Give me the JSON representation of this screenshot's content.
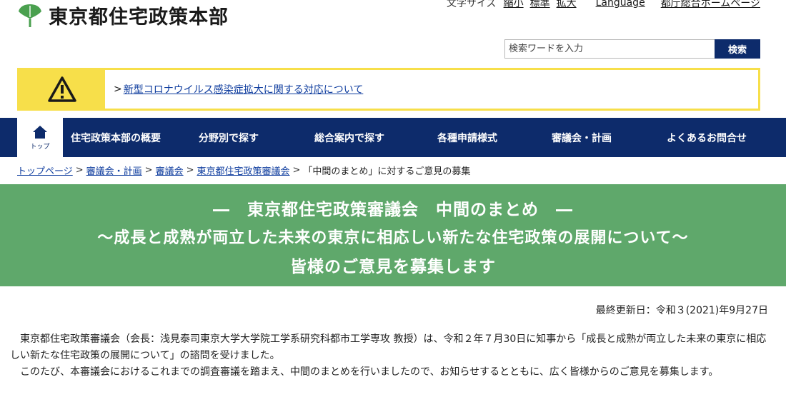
{
  "header": {
    "site_title": "東京都住宅政策本部",
    "logo_icon": "ginkgo-leaf-icon",
    "logo_color": "#4aa04f",
    "font_size_label": "文字サイズ",
    "font_small": "縮小",
    "font_standard": "標準",
    "font_large": "拡大",
    "language": "Language",
    "tocho_home": "都庁総合ホームページ"
  },
  "search": {
    "placeholder": "検索ワードを入力",
    "button_label": "検索"
  },
  "alert": {
    "icon": "warning-triangle-icon",
    "arrow": ">",
    "link_text": "新型コロナウイルス感染症拡大に関する対応について",
    "color": "#f7df4a"
  },
  "nav": {
    "home_label": "トップ",
    "items": [
      {
        "label": "住宅政策本部の概要"
      },
      {
        "label": "分野別で探す"
      },
      {
        "label": "総合案内で探す"
      },
      {
        "label": "各種申請様式"
      },
      {
        "label": "審議会・計画"
      },
      {
        "label": "よくあるお問合せ"
      }
    ],
    "color": "#0d2b6b"
  },
  "breadcrumb": {
    "items": [
      {
        "label": "トップページ"
      },
      {
        "label": "審議会・計画"
      },
      {
        "label": "審議会"
      },
      {
        "label": "東京都住宅政策審議会"
      }
    ],
    "current": "「中間のまとめ」に対するご意見の募集",
    "separator": ">"
  },
  "banner": {
    "line1": "―　東京都住宅政策審議会　中間のまとめ　―",
    "line2": "～成長と成熟が両立した未来の東京に相応しい新たな住宅政策の展開について～",
    "line3": "皆様のご意見を募集します",
    "color": "#5fa86b"
  },
  "updated": "最終更新日：令和３(2021)年9月27日",
  "body": {
    "paragraph1": "東京都住宅政策審議会（会長：浅見泰司東京大学大学院工学系研究科都市工学専攻 教授）は、令和２年７月30日に知事から「成長と成熟が両立した未来の東京に相応しい新たな住宅政策の展開について」の諮問を受けました。",
    "paragraph2": "このたび、本審議会におけるこれまでの調査審議を踏まえ、中間のまとめを行いましたので、お知らせするとともに、広く皆様からのご意見を募集します。"
  }
}
